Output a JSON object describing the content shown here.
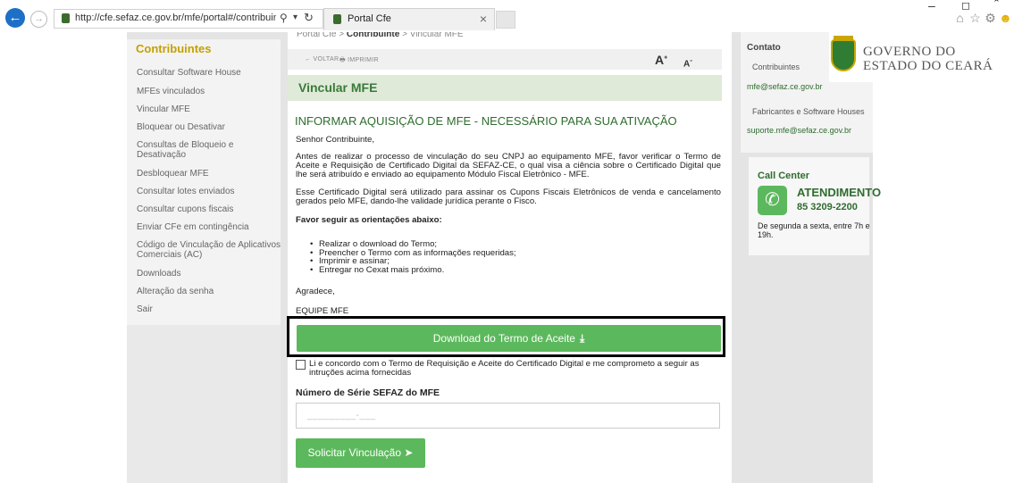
{
  "browser": {
    "url": "http://cfe.sefaz.ce.gov.br/mfe/portal#/contribuintes/\\",
    "tab_title": "Portal Cfe",
    "tab_close": "×",
    "back_icon": "arrow-left",
    "forward_icon": "arrow-right"
  },
  "sidebar": {
    "title": "Contribuintes",
    "items": [
      {
        "label": "Consultar Software House"
      },
      {
        "label": "MFEs vinculados"
      },
      {
        "label": "Vincular MFE"
      },
      {
        "label": "Bloquear ou Desativar"
      },
      {
        "label": "Consultas de Bloqueio e Desativação"
      },
      {
        "label": "Desbloquear MFE"
      },
      {
        "label": "Consultar lotes enviados"
      },
      {
        "label": "Consultar cupons fiscais"
      },
      {
        "label": "Enviar CFe em contingência"
      },
      {
        "label": "Código de Vinculação de Aplicativos Comerciais (AC)"
      },
      {
        "label": "Downloads"
      },
      {
        "label": "Alteração da senha"
      },
      {
        "label": "Sair"
      }
    ]
  },
  "main": {
    "breadcrumb": {
      "home": "Portal Cfe",
      "section": "Contribuinte",
      "page": "Vincular MFE"
    },
    "toolbar": {
      "voltar": "← VOLTAR",
      "imprimir": "IMPRIMIR",
      "font_up": "A",
      "font_down": "A"
    },
    "page_title": "Vincular MFE",
    "heading": "INFORMAR AQUISIÇÃO DE MFE - NECESSÁRIO PARA SUA ATIVAÇÃO",
    "greeting": "Senhor Contribuinte,",
    "para1": "Antes de realizar o processo de vinculação do seu CNPJ ao equipamento MFE, favor verificar o Termo de Aceite e Requisição de Certificado Digital da SEFAZ-CE, o qual visa a ciência sobre o Certificado Digital que lhe será atribuído e enviado ao equipamento Módulo Fiscal Eletrônico - MFE.",
    "para2": "Esse Certificado Digital será utilizado para assinar os Cupons Fiscais Eletrônicos de venda e cancelamento gerados pelo MFE, dando-lhe validade jurídica perante o Fisco.",
    "orient_title": "Favor seguir as orientações abaixo:",
    "bullets": [
      "Realizar o download do Termo;",
      "Preencher o Termo com as informações requeridas;",
      "Imprimir e assinar;",
      "Entregar no Cexat mais próximo."
    ],
    "agradece": "Agradece,",
    "equipe": "EQUIPE MFE",
    "download_button": "Download do Termo de Aceite",
    "checkbox_label": "Li e concordo com o Termo de Requisição e Aceite do Certificado Digital e me comprometo a seguir as intruções acima fornecidas",
    "serie_label": "Número de Série SEFAZ do MFE",
    "serie_placeholder": "_________-___",
    "submit_button": "Solicitar Vinculação"
  },
  "contact": {
    "title": "Contato",
    "contribuintes_label": "Contribuintes",
    "contribuintes_email": "mfe@sefaz.ce.gov.br",
    "fabricantes_label": "Fabricantes e Software Houses",
    "fabricantes_email": "suporte.mfe@sefaz.ce.gov.br"
  },
  "gov": {
    "line1": "GOVERNO DO",
    "line2": "ESTADO DO CEARÁ"
  },
  "callcenter": {
    "title": "Call Center",
    "atendimento": "ATENDIMENTO",
    "phone": "85 3209-2200",
    "hours": "De segunda a sexta, entre 7h e 19h."
  },
  "colors": {
    "primary_green": "#5cb85c",
    "heading_green": "#2f6c2f",
    "sidebar_title": "#c4a000"
  }
}
